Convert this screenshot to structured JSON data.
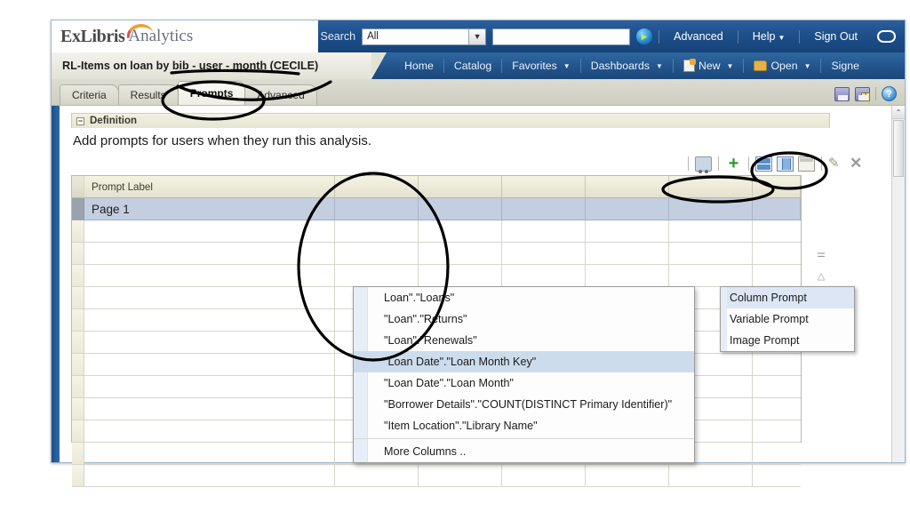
{
  "header": {
    "logo_ex": "ExLibris",
    "logo_product": "Analytics",
    "search_label": "Search",
    "search_scope_value": "All",
    "search_query_value": "",
    "search_query_placeholder": "",
    "go_icon": "go-arrow-icon",
    "links": [
      {
        "label": "Advanced",
        "caret": false
      },
      {
        "label": "Help",
        "caret": true
      },
      {
        "label": "Sign Out",
        "caret": false
      }
    ]
  },
  "navbar": {
    "report_title": "RL-Items on loan by bib - user - month (CECILE)",
    "items": [
      {
        "label": "Home",
        "caret": false,
        "icon": ""
      },
      {
        "label": "Catalog",
        "caret": false,
        "icon": ""
      },
      {
        "label": "Favorites",
        "caret": true,
        "icon": ""
      },
      {
        "label": "Dashboards",
        "caret": true,
        "icon": ""
      },
      {
        "label": "New",
        "caret": true,
        "icon": "new-page-icon"
      },
      {
        "label": "Open",
        "caret": true,
        "icon": "open-folder-icon"
      },
      {
        "label": "Signe",
        "caret": false,
        "icon": ""
      }
    ]
  },
  "tabs": {
    "items": [
      {
        "label": "Criteria",
        "active": false
      },
      {
        "label": "Results",
        "active": false
      },
      {
        "label": "Prompts",
        "active": true
      },
      {
        "label": "Advanced",
        "active": false
      }
    ],
    "tools": [
      {
        "name": "save-icon",
        "title": "Save"
      },
      {
        "name": "save-as-icon",
        "title": "Save As"
      },
      {
        "name": "help-icon",
        "title": "Help",
        "label": "?"
      }
    ]
  },
  "definition": {
    "section_title": "Definition",
    "collapse_glyph": "−",
    "description": "Add prompts for users when they run this analysis."
  },
  "grid_toolbar": {
    "icons": [
      {
        "name": "cart-icon"
      },
      {
        "name": "add-plus-icon",
        "glyph": "+"
      },
      {
        "name": "layout-horizontal-icon"
      },
      {
        "name": "layout-vertical-icon"
      },
      {
        "name": "layout-grid-icon"
      },
      {
        "name": "edit-pencil-icon",
        "glyph": "✎"
      },
      {
        "name": "delete-x-icon",
        "glyph": "✕"
      }
    ]
  },
  "grid": {
    "columns": [
      "Prompt Label",
      "",
      "",
      "",
      "",
      "",
      ""
    ],
    "rows": [
      {
        "cells": [
          "Page 1",
          "",
          "",
          "",
          "",
          "",
          ""
        ],
        "selected": true
      },
      {
        "cells": [
          "",
          "",
          "",
          "",
          "",
          "",
          ""
        ],
        "selected": false
      },
      {
        "cells": [
          "",
          "",
          "",
          "",
          "",
          "",
          ""
        ],
        "selected": false
      },
      {
        "cells": [
          "",
          "",
          "",
          "",
          "",
          "",
          ""
        ],
        "selected": false
      },
      {
        "cells": [
          "",
          "",
          "",
          "",
          "",
          "",
          ""
        ],
        "selected": false
      },
      {
        "cells": [
          "",
          "",
          "",
          "",
          "",
          "",
          ""
        ],
        "selected": false
      },
      {
        "cells": [
          "",
          "",
          "",
          "",
          "",
          "",
          ""
        ],
        "selected": false
      },
      {
        "cells": [
          "",
          "",
          "",
          "",
          "",
          "",
          ""
        ],
        "selected": false
      },
      {
        "cells": [
          "",
          "",
          "",
          "",
          "",
          "",
          ""
        ],
        "selected": false
      },
      {
        "cells": [
          "",
          "",
          "",
          "",
          "",
          "",
          ""
        ],
        "selected": false
      },
      {
        "cells": [
          "",
          "",
          "",
          "",
          "",
          "",
          ""
        ],
        "selected": false
      },
      {
        "cells": [
          "",
          "",
          "",
          "",
          "",
          "",
          ""
        ],
        "selected": false
      },
      {
        "cells": [
          "",
          "",
          "",
          "",
          "",
          "",
          ""
        ],
        "selected": false
      }
    ]
  },
  "sort_arrows": [
    {
      "name": "move-to-top-icon",
      "glyph": "⧉"
    },
    {
      "name": "move-up-icon",
      "glyph": "△"
    },
    {
      "name": "move-down-icon",
      "glyph": "▽"
    },
    {
      "name": "move-to-bottom-icon",
      "glyph": "⧉"
    }
  ],
  "prompt_type_menu": {
    "items": [
      {
        "label": "Column Prompt",
        "selected": true
      },
      {
        "label": "Variable Prompt",
        "selected": false
      },
      {
        "label": "Image Prompt",
        "selected": false
      }
    ]
  },
  "column_flyout": {
    "items": [
      {
        "label": "Loan\".\"Loans\"",
        "highlight": false
      },
      {
        "label": "\"Loan\".\"Returns\"",
        "highlight": false
      },
      {
        "label": "\"Loan\".\"Renewals\"",
        "highlight": false
      },
      {
        "label": "\"Loan Date\".\"Loan Month Key\"",
        "highlight": true
      },
      {
        "label": "\"Loan Date\".\"Loan Month\"",
        "highlight": false
      },
      {
        "label": "\"Borrower Details\".\"COUNT(DISTINCT Primary Identifier)\"",
        "highlight": false
      },
      {
        "label": "\"Item Location\".\"Library Name\"",
        "highlight": false
      }
    ],
    "more_label": "More Columns .."
  },
  "scrollbar": {
    "up_glyph": "⌃"
  },
  "colors": {
    "header_blue": "#1d4f89",
    "nav_blue": "#22548c",
    "tab_active": "#fbfbf6",
    "row_selected": "#c3cfe0",
    "flyout_highlight": "#ccdcec",
    "annotation": "#000000"
  }
}
